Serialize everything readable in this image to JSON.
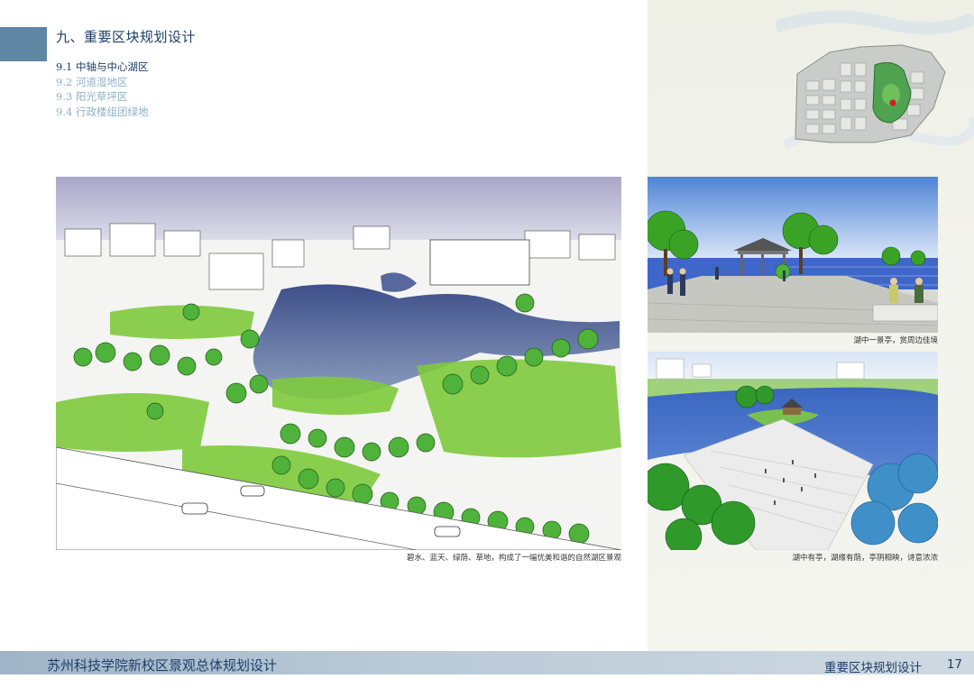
{
  "section": {
    "title": "九、重要区块规划设计",
    "items": [
      {
        "label": "9.1 中轴与中心湖区",
        "active": true
      },
      {
        "label": "9.2 河道湿地区",
        "active": false
      },
      {
        "label": "9.3 阳光草坪区",
        "active": false
      },
      {
        "label": "9.4 行政楼组团绿地",
        "active": false
      }
    ]
  },
  "images": {
    "main": {
      "caption": "碧水、蓝天、绿荫、草地，构成了一幅优美和谐的自然湖区景观"
    },
    "top_right": {
      "caption": "湖中一景亭，赏周边佳境"
    },
    "bottom_right": {
      "caption": "湖中有亭，湖缘有荫，亭阴相映，诗意浓浓"
    }
  },
  "footer": {
    "project_title": "苏州科技学院新校区景观总体规划设计",
    "section_name": "重要区块规划设计",
    "page_number": "17"
  },
  "colors": {
    "brand": "#1e3f6a",
    "accent": "#5f86a3",
    "inactive": "#8fb0c6"
  }
}
